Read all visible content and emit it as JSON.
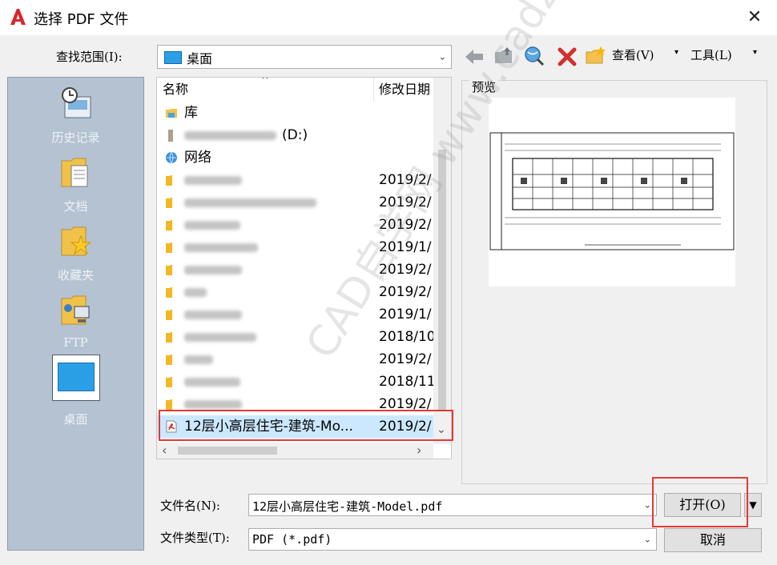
{
  "window": {
    "title": "选择 PDF 文件"
  },
  "lookin": {
    "label": "查找范围(I):",
    "value": "桌面"
  },
  "toolbar": {
    "view_label": "查看(V)",
    "tools_label": "工具(L)"
  },
  "places": [
    {
      "label": "历史记录"
    },
    {
      "label": "文档"
    },
    {
      "label": "收藏夹"
    },
    {
      "label": "FTP"
    },
    {
      "label": "桌面"
    }
  ],
  "filelist": {
    "col_name": "名称",
    "col_date": "修改日期",
    "special_rows": [
      {
        "name": "库",
        "icon": "library-icon"
      },
      {
        "name": "(D:)",
        "icon": "drive-icon"
      },
      {
        "name": "网络",
        "icon": "network-icon"
      }
    ],
    "folder_dates": [
      "2019/2/",
      "2019/2/",
      "2019/2/",
      "2019/1/",
      "2019/2/",
      "2019/2/",
      "2019/1/",
      "2018/10",
      "2019/2/",
      "2018/11",
      "2019/2/"
    ],
    "selected_file": {
      "name": "12层小高层住宅-建筑-Mo...",
      "date": "2019/2/",
      "icon": "pdf-icon"
    }
  },
  "preview": {
    "label": "预览"
  },
  "filename": {
    "label": "文件名(N):",
    "value": "12层小高层住宅-建筑-Model.pdf"
  },
  "filetype": {
    "label": "文件类型(T):",
    "value": "PDF (*.pdf)"
  },
  "buttons": {
    "open": "打开(O)",
    "cancel": "取消"
  },
  "watermark": {
    "text": "CAD自学网 www.cadzxw.com"
  },
  "colors": {
    "sidebar_bg": "#b4c2d2",
    "highlight_red": "#e53935",
    "selection_bg": "#cce8ff"
  }
}
